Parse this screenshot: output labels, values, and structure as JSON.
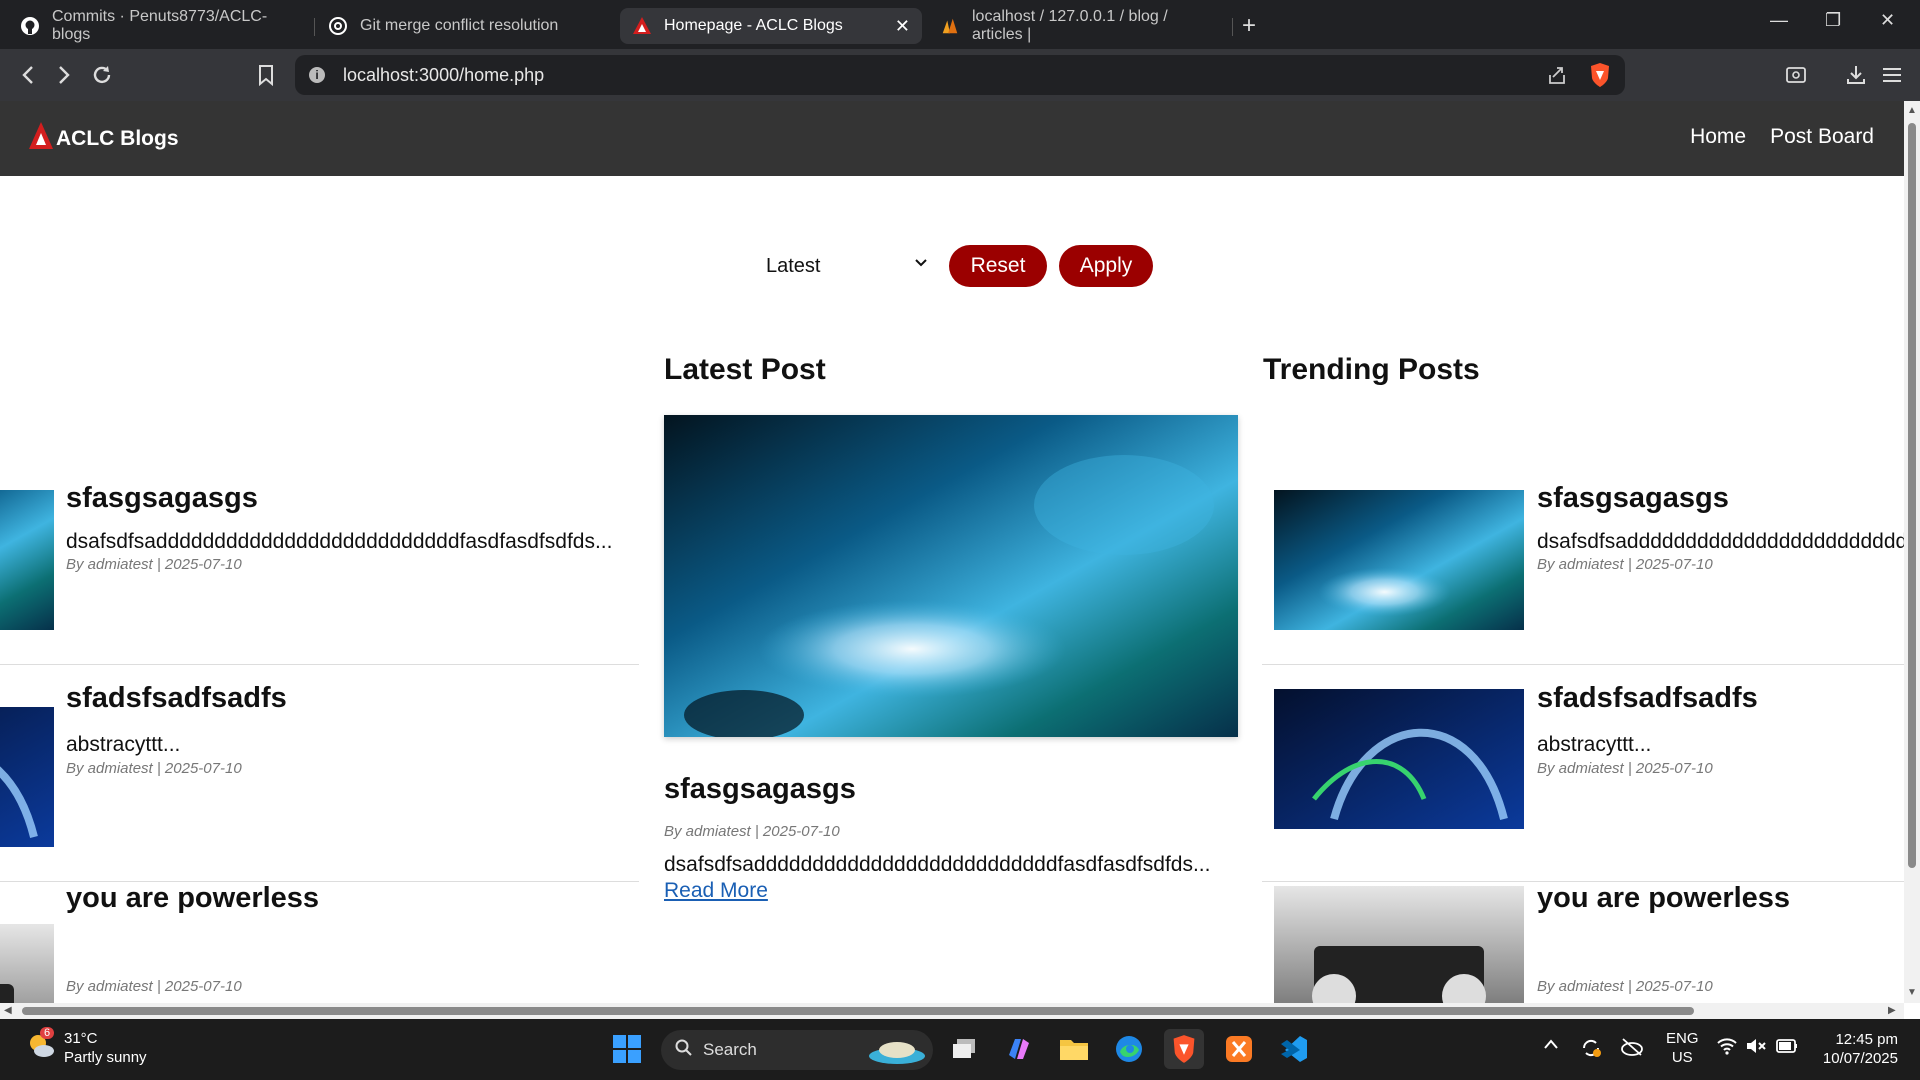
{
  "browser": {
    "tabs": [
      {
        "title": "Commits · Penuts8773/ACLC-blogs",
        "icon": "github-icon"
      },
      {
        "title": "Git merge conflict resolution",
        "icon": "openai-icon"
      },
      {
        "title": "Homepage - ACLC Blogs",
        "icon": "aclc-logo-icon",
        "active": true
      },
      {
        "title": "localhost / 127.0.0.1 / blog / articles |",
        "icon": "phpmyadmin-icon"
      }
    ],
    "url": "localhost:3000/home.php"
  },
  "site": {
    "brand": "ACLC Blogs",
    "brand_color": "#9b0000",
    "header_color": "#343434",
    "nav": [
      "Home",
      "Post Board"
    ]
  },
  "filter": {
    "selected": "Latest",
    "reset_label": "Reset",
    "apply_label": "Apply"
  },
  "left_posts": [
    {
      "title": "sfasgsagasgs",
      "excerpt": "dsafsdfsaddddddddddddddddddddddddddfasdfasdfsdfds...",
      "meta": "By admiatest | 2025-07-10",
      "image": "blue-fluid-art"
    },
    {
      "title": "sfadsfsadfsadfs",
      "excerpt": "abstracyttt...",
      "meta": "By admiatest | 2025-07-10",
      "image": "light-streak-abstract"
    },
    {
      "title": "you are powerless",
      "excerpt": "",
      "meta": "By admiatest | 2025-07-10",
      "image": "typewriter-bw"
    }
  ],
  "latest": {
    "heading": "Latest Post",
    "title": "sfasgsagasgs",
    "meta": "By admiatest | 2025-07-10",
    "excerpt": "dsafsdfsaddddddddddddddddddddddddddfasdfasdfsdfds...",
    "read_more": "Read More",
    "image": "blue-fluid-art"
  },
  "trending": {
    "heading": "Trending Posts",
    "posts": [
      {
        "title": "sfasgsagasgs",
        "excerpt": "dsafsdfsaddddddddddddddddddddddddddfasdfasdfsdfds...",
        "meta": "By admiatest | 2025-07-10",
        "image": "blue-fluid-art"
      },
      {
        "title": "sfadsfsadfsadfs",
        "excerpt": "abstracyttt...",
        "meta": "By admiatest | 2025-07-10",
        "image": "light-streak-abstract"
      },
      {
        "title": "you are powerless",
        "excerpt": "",
        "meta": "By admiatest | 2025-07-10",
        "image": "typewriter-bw"
      }
    ]
  },
  "taskbar": {
    "weather_temp": "31°C",
    "weather_desc": "Partly sunny",
    "weather_badge": "6",
    "search_label": "Search",
    "lang_top": "ENG",
    "lang_bottom": "US",
    "time": "12:45 pm",
    "date": "10/07/2025"
  }
}
